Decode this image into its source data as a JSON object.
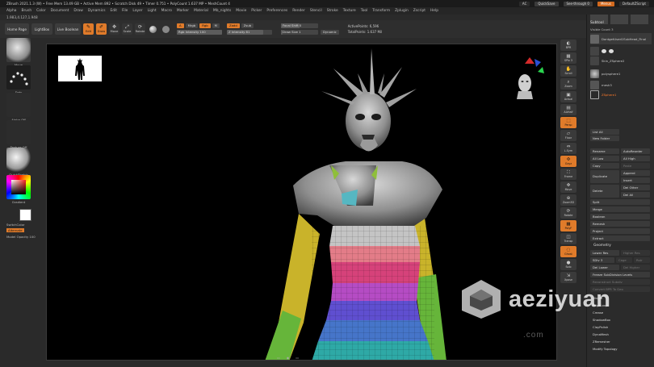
{
  "titlebar": {
    "app_info": "ZBrush 2021.1.3 (W)  • Free Mem 13.49 GB • Active Mem 892 • Scratch Disk 49 • Timer 0.751 • PolyCount 1.637 MP • MeshCount 4",
    "ac": "AC",
    "quicksave": "QuickSave",
    "see_through": "See-through  0",
    "menus": "Menus",
    "default_script": "DefaultZScript"
  },
  "menubar": {
    "items": [
      "Alpha",
      "Brush",
      "Color",
      "Document",
      "Draw",
      "Dynamics",
      "Edit",
      "File",
      "Layer",
      "Light",
      "Macro",
      "Marker",
      "Material",
      "Mb_nights",
      "Movie",
      "Picker",
      "Preferences",
      "Render",
      "Stencil",
      "Stroke",
      "Texture",
      "Tool",
      "Transform",
      "Zplugin",
      "Zscript",
      "Help"
    ]
  },
  "infoline": "1.983,4.127,1.948",
  "toolbar": {
    "home_page": "Home Page",
    "lightbox": "LightBox",
    "live_boolean": "Live Boolean",
    "edit": "Edit",
    "draw": "Draw",
    "move": "Move",
    "scale": "Scale",
    "rotate": "Rotate",
    "a_label": "A",
    "mrgb": "Mrgb",
    "rgb": "Rgb",
    "m": "M",
    "rgb_intensity": "Rgb Intensity 100",
    "zadd": "Zadd",
    "zsub": "Zsub",
    "z_intensity": "Z Intensity 81",
    "focal_shift": "Focal Shift 0",
    "draw_size": "Draw Size 1",
    "dynamic": "Dynamic",
    "active_points": "ActivePoints: 6,596",
    "total_points": "TotalPoints: 1.637 Mil"
  },
  "left_palette": {
    "brush_label": "Move",
    "stroke_label": "Dots",
    "alpha_label": "Alpha Off",
    "texture_label": "Texture Off",
    "material_label": "QuickSketch",
    "gradient_label": "Gradient",
    "switch_color": "SwitchColor",
    "alternate": "Alternate",
    "model_opacity": "Model Opacity 100"
  },
  "right_shelf": [
    {
      "name": "BPR",
      "label": "BPR"
    },
    {
      "name": "SPix",
      "label": "SPix 3"
    },
    {
      "name": "Scroll",
      "label": "Scroll"
    },
    {
      "name": "Zoom",
      "label": "Zoom"
    },
    {
      "name": "Actual",
      "label": "Actual"
    },
    {
      "name": "AAHalf",
      "label": "AAHalf"
    },
    {
      "name": "Persp",
      "label": "Persp"
    },
    {
      "name": "Floor",
      "label": "Floor"
    },
    {
      "name": "LSym",
      "label": "L.Sym"
    },
    {
      "name": "Gxyz",
      "label": "Gxyz"
    },
    {
      "name": "Frame",
      "label": "Frame"
    },
    {
      "name": "Move",
      "label": "Move"
    },
    {
      "name": "ZoomD",
      "label": "Zoom3D"
    },
    {
      "name": "Rotate",
      "label": "Rotate"
    },
    {
      "name": "PolyF",
      "label": "PolyF"
    },
    {
      "name": "Transp",
      "label": "Transp"
    },
    {
      "name": "Ghost",
      "label": "Ghost"
    },
    {
      "name": "Solo",
      "label": "Solo"
    },
    {
      "name": "Xpose",
      "label": "Xpose"
    }
  ],
  "subtool": {
    "header": "Subtool",
    "visible_count": "Visible Count 3",
    "items": [
      {
        "name": "DontgetUsed1SubHead_Final"
      },
      {
        "name": "Skin_ZSphere2"
      },
      {
        "name": "polysphere1"
      },
      {
        "name": "mesh3"
      },
      {
        "name": "ZSphere1"
      }
    ],
    "list_all": "List All",
    "new_folder": "New Folder",
    "rename": "Rename",
    "auto_reorder": "AutoReorder",
    "all_low": "All Low",
    "all_high": "All High",
    "copy": "Copy",
    "paste": "Paste",
    "duplicate": "Duplicate",
    "append": "Append",
    "insert": "Insert",
    "delete": "Delete",
    "del_other": "Del Other",
    "del_all": "Del All",
    "split": "Split",
    "merge": "Merge",
    "boolean": "Boolean",
    "remesh": "Remesh",
    "project": "Project",
    "extract": "Extract"
  },
  "geometry": {
    "header": "Geometry",
    "lower_res": "Lower Res",
    "higher_res": "Higher Res",
    "sdiv": "SDiv 3",
    "cage": "Cage",
    "rstr": "Rstr",
    "del_lower": "Del Lower",
    "del_higher": "Del Higher",
    "freeze": "Freeze SubDivision Levels",
    "reconstruct": "Reconstruct Subdiv",
    "convert_bpr": "Convert BPR To Geo",
    "items": [
      "Divide",
      "EdgeLoop",
      "Crease",
      "ShadowBox",
      "ClayPolish",
      "DynaMesh",
      "ZRemesher",
      "Modify Topology"
    ]
  },
  "watermark": {
    "text": "aeziyuan",
    "sub": ".com"
  }
}
